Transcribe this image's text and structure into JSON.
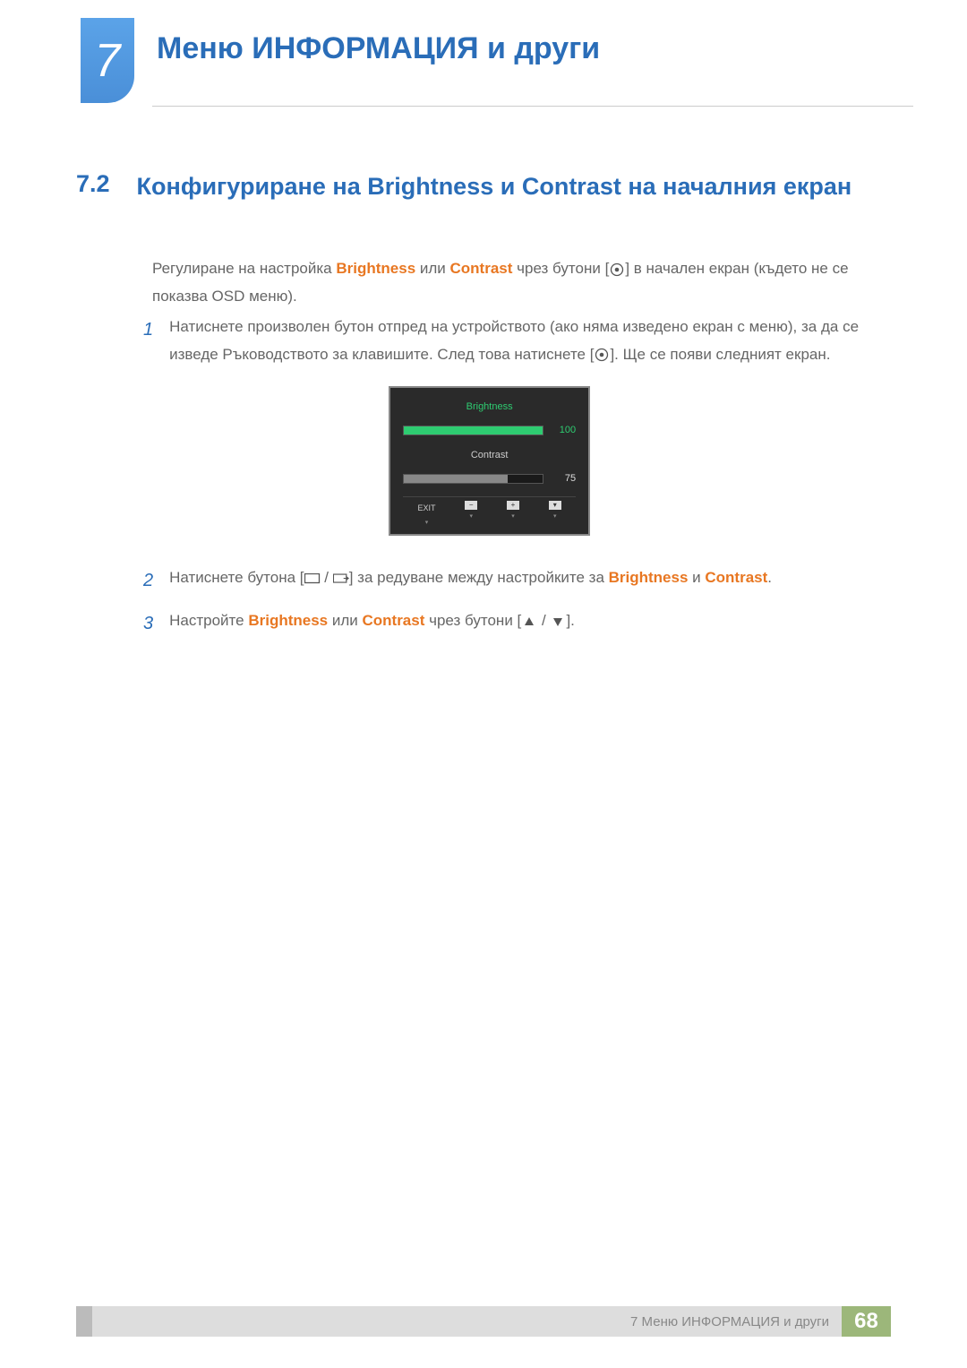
{
  "chapter": {
    "number": "7",
    "title": "Меню ИНФОРМАЦИЯ и други"
  },
  "section": {
    "number": "7.2",
    "title": "Конфигуриране на Brightness и Contrast на началния екран"
  },
  "intro_pre": "Регулиране на настройка ",
  "intro_brightness": "Brightness",
  "intro_or": " или ",
  "intro_contrast": "Contrast",
  "intro_post": " чрез бутони [",
  "intro_end": "] в начален екран (където не се показва OSD меню).",
  "steps": {
    "s1": {
      "num": "1",
      "pre": "Натиснете произволен бутон отпред на устройството (ако няма изведено екран с меню), за да се изведе Ръководството за клавишите. След това натиснете [",
      "post": "]. Ще се появи следният екран."
    },
    "s2": {
      "num": "2",
      "pre": "Натиснете бутона [",
      "mid": "] за редуване между настройките за ",
      "b": "Brightness",
      "and": " и ",
      "c": "Contrast",
      "end": "."
    },
    "s3": {
      "num": "3",
      "pre": "Настройте ",
      "b": "Brightness",
      "or": " или ",
      "c": "Contrast",
      "mid": " чрез бутони [",
      "end": "]."
    }
  },
  "osd": {
    "brightness_label": "Brightness",
    "brightness_value": "100",
    "contrast_label": "Contrast",
    "contrast_value": "75",
    "exit": "EXIT",
    "minus": "−",
    "plus": "+",
    "down": "▾"
  },
  "footer": {
    "text": "7 Меню ИНФОРМАЦИЯ и други",
    "page": "68"
  },
  "chart_data": {
    "type": "bar",
    "title": "OSD Brightness/Contrast panel",
    "series": [
      {
        "name": "Brightness",
        "values": [
          100
        ]
      },
      {
        "name": "Contrast",
        "values": [
          75
        ]
      }
    ],
    "ylim": [
      0,
      100
    ]
  }
}
